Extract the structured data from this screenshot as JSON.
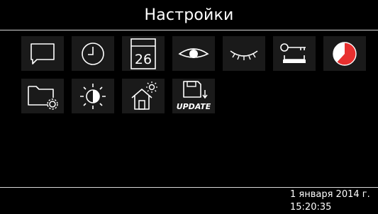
{
  "header": {
    "title": "Настройки"
  },
  "tiles": [
    {
      "icon": "chat-bubble-icon"
    },
    {
      "icon": "clock-icon"
    },
    {
      "icon": "calendar-icon",
      "text": "26"
    },
    {
      "icon": "eye-open-icon"
    },
    {
      "icon": "eye-closed-icon"
    },
    {
      "icon": "key-icon"
    },
    {
      "icon": "timer-pie-icon",
      "accent": "#e8302f"
    },
    {
      "icon": "folder-settings-icon"
    },
    {
      "icon": "brightness-icon"
    },
    {
      "icon": "home-sun-icon"
    },
    {
      "icon": "save-update-icon",
      "text": "UPDATE"
    }
  ],
  "footer": {
    "date": "1 января 2014 г.",
    "time": "15:20:35"
  }
}
